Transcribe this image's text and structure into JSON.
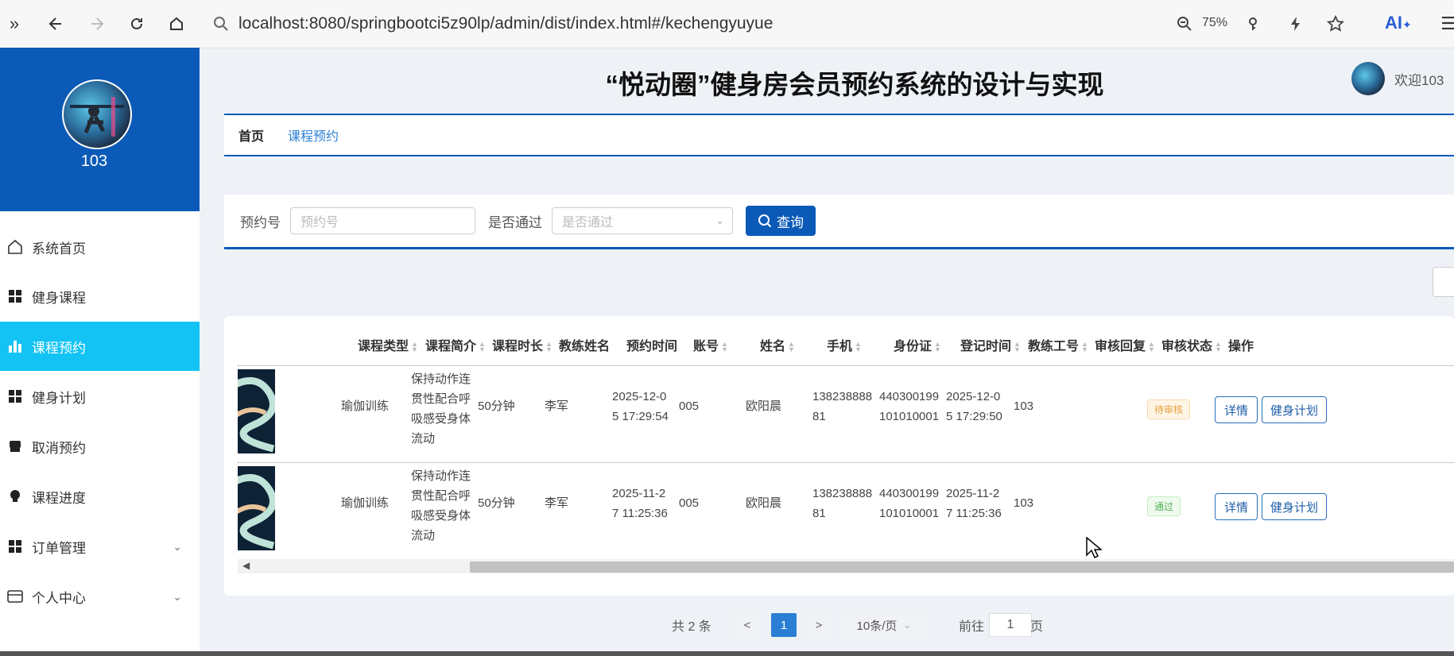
{
  "browser": {
    "url": "localhost:8080/springbootci5z90lp/admin/dist/index.html#/kechengyuyue",
    "zoom": "75%",
    "ai_label": "AI"
  },
  "sidebar": {
    "username": "103",
    "items": [
      {
        "label": "系统首页",
        "icon": "home-icon"
      },
      {
        "label": "健身课程",
        "icon": "grid-icon"
      },
      {
        "label": "课程预约",
        "icon": "bar-chart-icon",
        "active": true
      },
      {
        "label": "健身计划",
        "icon": "grid-icon"
      },
      {
        "label": "取消预约",
        "icon": "store-icon"
      },
      {
        "label": "课程进度",
        "icon": "bulb-icon"
      },
      {
        "label": "订单管理",
        "icon": "grid-icon",
        "expandable": true
      },
      {
        "label": "个人中心",
        "icon": "card-icon",
        "expandable": true
      }
    ]
  },
  "header": {
    "title": "“悦动圈”健身房会员预约系统的设计与实现",
    "welcome": "欢迎103"
  },
  "breadcrumb": {
    "home": "首页",
    "current": "课程预约"
  },
  "search": {
    "booking_label": "预约号",
    "booking_placeholder": "预约号",
    "pass_label": "是否通过",
    "pass_placeholder": "是否通过",
    "query_label": "查询"
  },
  "table": {
    "headers": [
      "课程类型",
      "课程简介",
      "课程时长",
      "教练姓名",
      "预约时间",
      "账号",
      "姓名",
      "手机",
      "身份证",
      "登记时间",
      "教练工号",
      "审核回复",
      "审核状态",
      "操作"
    ],
    "rows": [
      {
        "type": "瑜伽训练",
        "intro": [
          "保持动作连",
          "贯性配合呼",
          "吸感受身体",
          "流动"
        ],
        "duration": "50分钟",
        "coach": "李军",
        "book_time": [
          "2025-12-0",
          "5 17:29:54"
        ],
        "account": "005",
        "name": "欧阳晨",
        "phone": [
          "138238888",
          "81"
        ],
        "idcard": [
          "440300199",
          "101010001"
        ],
        "reg_time": [
          "2025-12-0",
          "5 17:29:50"
        ],
        "coach_no": "103",
        "reply": "",
        "status": "待审核",
        "detail": "详情",
        "plan": "健身计划"
      },
      {
        "type": "瑜伽训练",
        "intro": [
          "保持动作连",
          "贯性配合呼",
          "吸感受身体",
          "流动"
        ],
        "duration": "50分钟",
        "coach": "李军",
        "book_time": [
          "2025-11-2",
          "7 11:25:36"
        ],
        "account": "005",
        "name": "欧阳晨",
        "phone": [
          "138238888",
          "81"
        ],
        "idcard": [
          "440300199",
          "101010001"
        ],
        "reg_time": [
          "2025-11-2",
          "7 11:25:36"
        ],
        "coach_no": "103",
        "reply": "",
        "status": "通过",
        "detail": "详情",
        "plan": "健身计划"
      }
    ]
  },
  "pagination": {
    "total": "共 2 条",
    "prev": "<",
    "page": "1",
    "next": ">",
    "page_size": "10条/页",
    "goto_label": "前往",
    "goto_value": "1",
    "page_suffix": "页"
  },
  "colors": {
    "primary": "#0b5ab8",
    "active_menu": "#12c3f4",
    "pending": "#e6a23c",
    "approved": "#52b152"
  }
}
